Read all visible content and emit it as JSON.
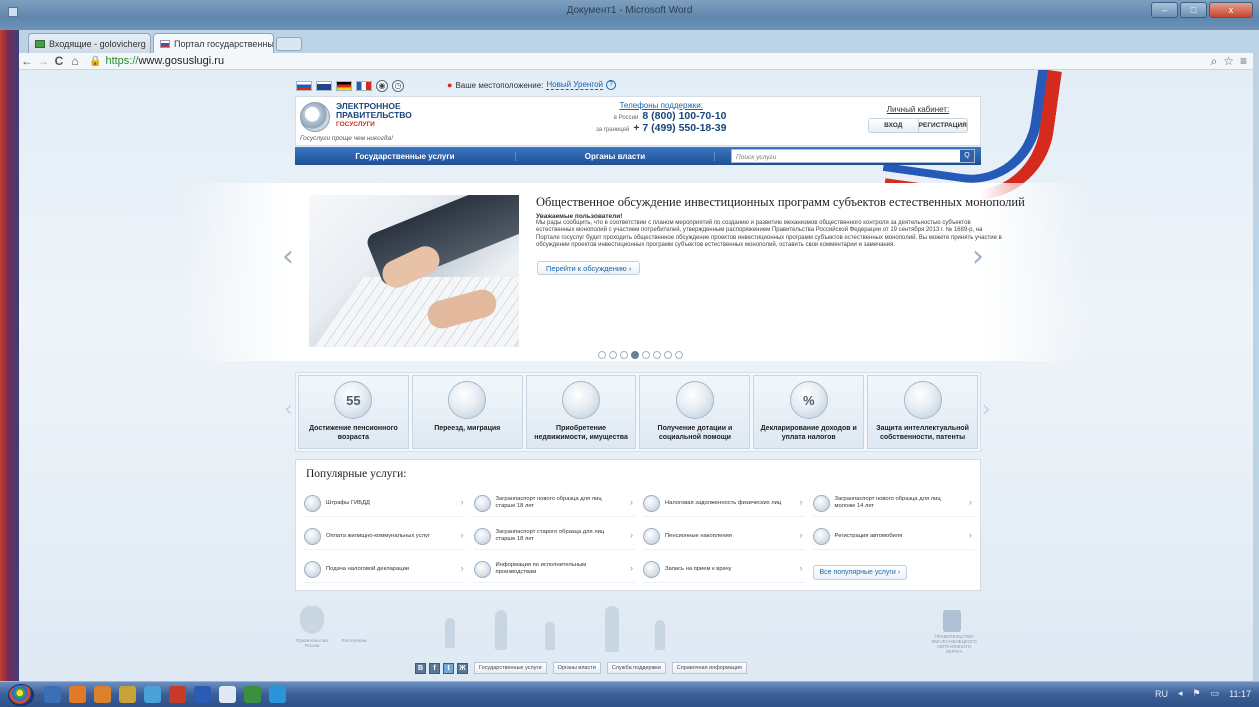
{
  "window": {
    "title": "Документ1 - Microsoft Word",
    "buttons": [
      "–",
      "□",
      "x"
    ]
  },
  "tabs": [
    {
      "label": "Входящие - golovicherg",
      "close": "×",
      "active": false
    },
    {
      "label": "Портал государственны",
      "close": "×",
      "active": true
    }
  ],
  "toolbar": {
    "url_scheme": "https://",
    "url_host": "www.gosuslugi.ru",
    "back": "←",
    "forward": "→",
    "reload": "C",
    "home": "⌂",
    "zoom_icon": "⌕",
    "star_icon": "☆",
    "menu_icon": "≡"
  },
  "header": {
    "location_label": "Ваше местоположение:",
    "location_city": "Новый Уренгой",
    "location_q": "?",
    "logo_line1": "ЭЛЕКТРОННОЕ",
    "logo_line2": "ПРАВИТЕЛЬСТВО",
    "logo_line3": "ГОСУСЛУГИ",
    "slogan": "Госуслуги проще чем никогда!",
    "support_title": "Телефоны поддержки:",
    "support_ru_label": "в России",
    "support_ru_phone": "8 (800) 100-70-10",
    "support_abroad_label": "за границей",
    "support_abroad_phone": "+ 7 (499) 550-18-39",
    "cabinet_title": "Личный кабинет:",
    "login": "ВХОД",
    "register": "РЕГИСТРАЦИЯ"
  },
  "nav": {
    "services": "Государственные услуги",
    "authorities": "Органы власти",
    "search_placeholder": "Поиск услуги",
    "search_btn": "Q"
  },
  "slide": {
    "title": "Общественное обсуждение инвестиционных программ субъектов естественных монополий",
    "greeting": "Уважаемые пользователи!",
    "body": "Мы рады сообщить, что в соответствии с планом мероприятий по созданию и развитию механизмов общественного контроля за деятельностью субъектов естественных монополий с участием потребителей, утвержденным распоряжением Правительства Российской Федерации от 19 сентября 2013 г. № 1689-р, на Портале госуслуг будет проходить общественное обсуждение проектов инвестиционных программ субъектов естественных монополий. Вы можете принять участие в обсуждении проектов инвестиционных программ субъектов естественных монополий, оставить свои комментарии и замечания.",
    "button": "Перейти к обсуждению  ›",
    "prev": "‹",
    "next": "›",
    "dots_total": 8,
    "dots_active": 4
  },
  "categories": [
    {
      "label": "Достижение пенсионного возраста",
      "icon_text": "55",
      "icon": "pension-icon"
    },
    {
      "label": "Переезд, миграция",
      "icon_text": "",
      "icon": "passport-icon"
    },
    {
      "label": "Приобретение недвижимости, имущества",
      "icon_text": "",
      "icon": "property-icon"
    },
    {
      "label": "Получение дотации и социальной помощи",
      "icon_text": "",
      "icon": "lifebuoy-icon"
    },
    {
      "label": "Декларирование доходов и уплата налогов",
      "icon_text": "%",
      "icon": "percent-icon"
    },
    {
      "label": "Защита интеллектуальной собственности, патенты",
      "icon_text": "",
      "icon": "patent-icon"
    }
  ],
  "popular": {
    "title": "Популярные услуги:",
    "items": [
      "Штрафы ГИБДД",
      "Загранпаспорт нового образца для лиц старше 18 лет",
      "Налоговая задолженность физических лиц",
      "Загранпаспорт нового образца для лиц моложе 14 лет",
      "Оплата жилищно-коммунальных услуг",
      "Загранпаспорт старого образца для лиц старше 18 лет",
      "Пенсионные накопления",
      "Регистрация автомобиля",
      "Подача налоговой декларации",
      "Информация по исполнительным производствам",
      "Запись на прием к врачу"
    ],
    "all_button": "Все популярные услуги  ›",
    "chevron": "›"
  },
  "footer": {
    "social": [
      "В",
      "f",
      "t",
      "Ж"
    ],
    "links": [
      "Государственные услуги",
      "Органы власти",
      "Служба поддержки",
      "Справочная информация"
    ],
    "cap_left": "Правительство России",
    "cap_left2": "Ростелеком",
    "cap_right": "ПРАВИТЕЛЬСТВО ЯМАЛО-НЕНЕЦКОГО АВТОНОМНОГО ОКРУГА"
  },
  "taskbar": {
    "lang": "RU",
    "time": "11:17"
  },
  "colors": {
    "brand_blue": "#1e4f95",
    "accent_red": "#d52b1e",
    "link": "#1b64a8"
  }
}
